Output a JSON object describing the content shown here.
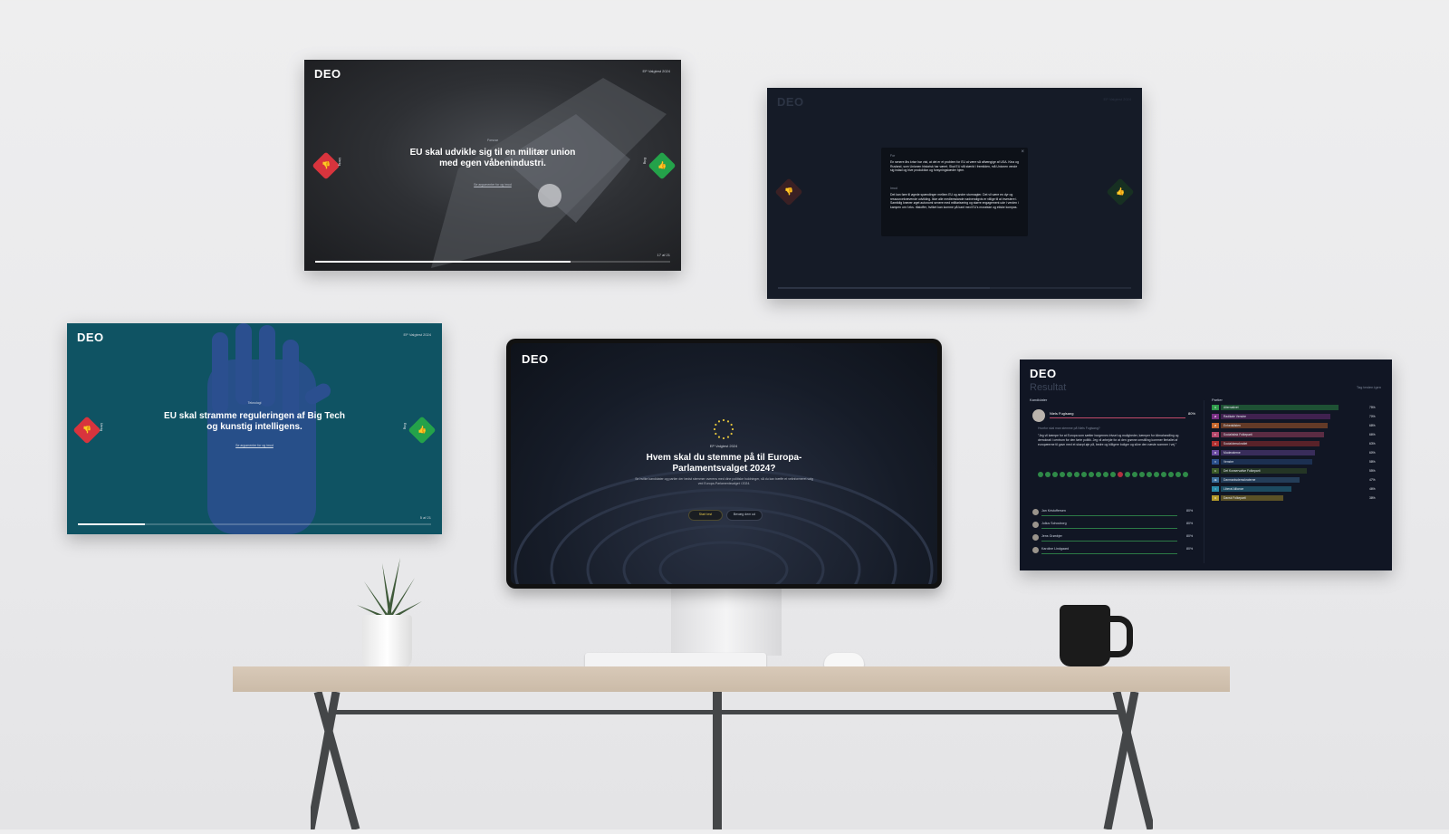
{
  "brand": "DEO",
  "panel_military": {
    "tag": "EP Valgtest 2024",
    "category": "Forsvar",
    "title": "EU skal udvikle sig til en militær union med egen våbenindustri.",
    "link": "Se argumenter for og imod",
    "counter": "17 af 21",
    "progress": 0.72,
    "disagree_label": "Uenig",
    "agree_label": "Enig"
  },
  "panel_info": {
    "tag": "EP Valgtest 2024",
    "para1_label": "For",
    "para1": "En senere års krise har vist, at det er et problem for EU at være så afhængige af USA. Kina og Rusland, som Unionen historisk har været. Skal EU stå stærkt i fremtiden, må Unionen vende sig indad og hive produktion og forsyningskæder hjem.",
    "para2_label": "Imod",
    "para2": "Det kan føre til øgede spændinger mellem EU og andre stormagter. Det vil være en dyr og ressourcekrævende udvikling. Ikke alle medlemslande nødvendigvis er villige til at investere i. Samtidig kræver øget autonomi senere med militarisering og større engagement ude i verden i kampen om f.eks. råstoffer, hvilket kan komme på kant med EU's moralske og etiske kompas."
  },
  "panel_tech": {
    "tag": "EP Valgtest 2024",
    "category": "Teknologi",
    "title": "EU skal stramme reguleringen af Big Tech og kunstig intelligens.",
    "link": "Se argumenter for og imod",
    "counter": "5 af 21",
    "progress": 0.19,
    "disagree_label": "Uenig",
    "agree_label": "Enig"
  },
  "panel_main": {
    "tag": "EP Valgtest 2024",
    "title": "Hvem skal du stemme på til Europa-Parlamentsvalget 2024?",
    "intro": "Se hvilke kandidater og partier der bedst stemmer overens med dine politiske holdninger, så du kan træffe et velinformeret valg ved Europa-Parlamentsvalget i 2024.",
    "start_button": "Start test",
    "secondary_button": "Bevæg dem ud"
  },
  "panel_result": {
    "heading": "Resultat",
    "top_right": "Tag testen igen",
    "candidates_label": "Kandidater",
    "parties_label": "Partier",
    "top_candidate": {
      "name": "Niels Fuglsang",
      "match": "80%"
    },
    "quote_label": "Hvorfor skal man stemme på Niels Fuglsang?",
    "quote": "\"Jeg vil kæmpe for at Europa som sætter borgernes trivsel og muligheder, kæmper for klimahandling og demokrati i centrum for den førte politik. Jeg vil arbejde for at den grønne omstilling kommer flertallet af europæerne til gavn med et skarpt øje på, bedre og billigere boliger og sikre den næste sommer i vej.\"",
    "candidates": [
      {
        "name": "Jan Kristoffersen",
        "match": "80%"
      },
      {
        "name": "Julius Schouborg",
        "match": "80%"
      },
      {
        "name": "Jens Grønbjer",
        "match": "80%"
      },
      {
        "name": "Karoline Lindgaard",
        "match": "80%"
      }
    ],
    "parties": [
      {
        "abbr": "Å",
        "name": "Alternativet",
        "value": 75,
        "label": "75%",
        "color": "#2e9a4a"
      },
      {
        "abbr": "Ø",
        "name": "Radikale Venstre",
        "value": 70,
        "label": "70%",
        "color": "#7a2f84"
      },
      {
        "abbr": "Ø",
        "name": "Enhedslisten",
        "value": 68,
        "label": "68%",
        "color": "#c7672c"
      },
      {
        "abbr": "F",
        "name": "Socialistisk Folkeparti",
        "value": 66,
        "label": "66%",
        "color": "#b5476a"
      },
      {
        "abbr": "A",
        "name": "Socialdemokratiet",
        "value": 63,
        "label": "63%",
        "color": "#b23030"
      },
      {
        "abbr": "M",
        "name": "Moderaterne",
        "value": 60,
        "label": "60%",
        "color": "#6a4aa0"
      },
      {
        "abbr": "V",
        "name": "Venstre",
        "value": 58,
        "label": "58%",
        "color": "#2a4f8a"
      },
      {
        "abbr": "C",
        "name": "Det Konservative Folkeparti",
        "value": 55,
        "label": "55%",
        "color": "#3c5a28"
      },
      {
        "abbr": "Æ",
        "name": "Danmarksdemokraterne",
        "value": 50,
        "label": "47%",
        "color": "#3b6d9a"
      },
      {
        "abbr": "I",
        "name": "Liberal Alliance",
        "value": 45,
        "label": "46%",
        "color": "#2a8aa8"
      },
      {
        "abbr": "O",
        "name": "Dansk Folkeparti",
        "value": 40,
        "label": "38%",
        "color": "#b59a2a"
      }
    ]
  }
}
